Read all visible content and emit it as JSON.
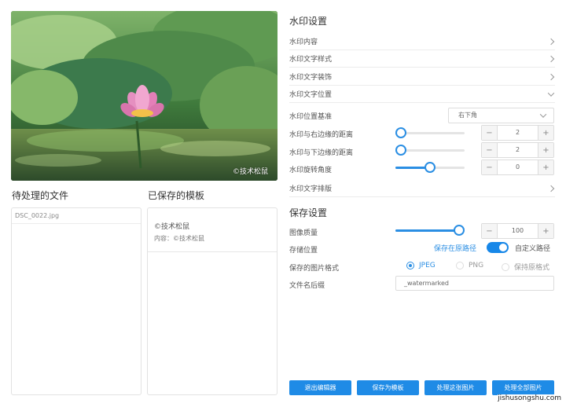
{
  "preview": {
    "watermark_text": "©技术松鼠"
  },
  "files": {
    "title": "待处理的文件",
    "items": [
      "DSC_0022.jpg"
    ]
  },
  "templates": {
    "title": "已保存的模板",
    "items": [
      {
        "name": "©技术松鼠",
        "content": "内容：©技术松鼠"
      }
    ]
  },
  "watermark_settings": {
    "title": "水印设置",
    "content_label": "水印内容",
    "text_style_label": "水印文字样式",
    "text_decoration_label": "水印文字装饰",
    "position_label": "水印文字位置",
    "position_base_label": "水印位置基准",
    "position_base_value": "右下角",
    "right_margin_label": "水印与右边缘的距离",
    "right_margin_value": "2",
    "right_margin_slider": 0.0,
    "bottom_margin_label": "水印与下边缘的距离",
    "bottom_margin_value": "2",
    "bottom_margin_slider": 0.0,
    "rotation_label": "水印旋转角度",
    "rotation_value": "0",
    "rotation_slider": 0.5,
    "layout_label": "水印文字排版"
  },
  "save_settings": {
    "title": "保存设置",
    "quality_label": "图像质量",
    "quality_value": "100",
    "quality_slider": 1.0,
    "location_label": "存储位置",
    "location_original": "保存在原路径",
    "location_custom": "自定义路径",
    "location_custom_on": true,
    "format_label": "保存的图片格式",
    "formats": [
      "JPEG",
      "PNG",
      "保持原格式"
    ],
    "format_selected": "JPEG",
    "suffix_label": "文件名后缀",
    "suffix_value": "_watermarked"
  },
  "actions": {
    "exit": "退出编辑器",
    "save_template": "保存为模板",
    "process_this": "处理这张图片",
    "process_all": "处理全部图片"
  },
  "site_mark": "jishusongshu.com",
  "colors": {
    "accent": "#2a8ee3",
    "button": "#1f8be6"
  },
  "icons": {
    "expand": "chevron-right-icon",
    "collapse": "chevron-down-icon",
    "minus": "minus-icon",
    "plus": "plus-icon"
  }
}
